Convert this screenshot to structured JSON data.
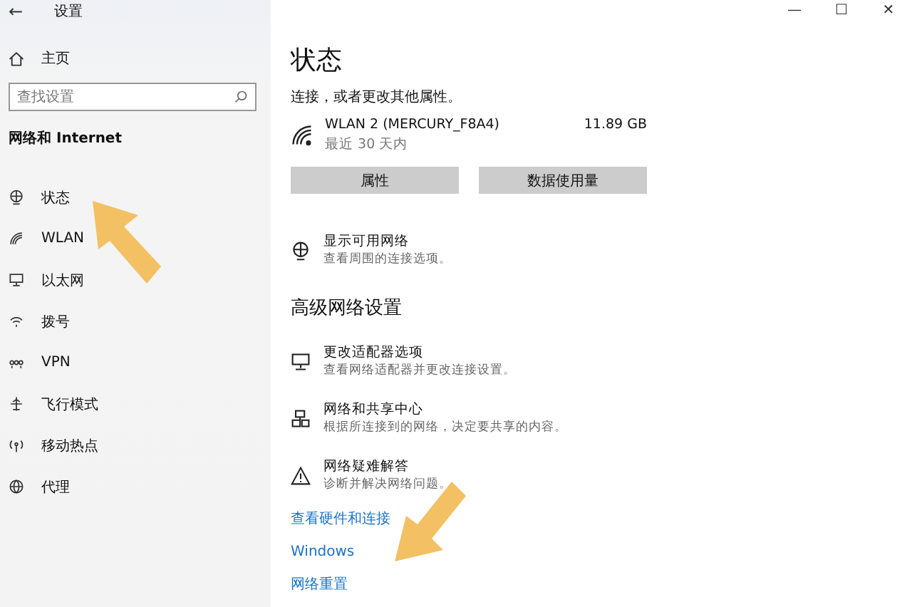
{
  "window": {
    "title": "设置",
    "back": "←",
    "controls": [
      "—",
      "☐",
      "✕"
    ]
  },
  "sidebar": {
    "home": "主页",
    "search": {
      "placeholder": "查找设置"
    },
    "heading": "网络和 Internet",
    "items": [
      {
        "label": "状态"
      },
      {
        "label": "WLAN"
      },
      {
        "label": "以太网"
      },
      {
        "label": "拨号"
      },
      {
        "label": "VPN"
      },
      {
        "label": "飞行模式"
      },
      {
        "label": "移动热点"
      },
      {
        "label": "代理"
      }
    ]
  },
  "main": {
    "title": "状态",
    "description": "连接，或者更改其他属性。",
    "connection": {
      "name": "WLAN 2 (MERCURY_F8A4)",
      "period": "最近 30 天内",
      "usage": "11.89 GB"
    },
    "buttons": [
      "属性",
      "数据使用量"
    ],
    "show_networks": {
      "title": "显示可用网络",
      "subtitle": "查看周围的连接选项。"
    },
    "advanced_heading": "高级网络设置",
    "advanced_items": [
      {
        "title": "更改适配器选项",
        "subtitle": "查看网络适配器并更改连接设置。"
      },
      {
        "title": "网络和共享中心",
        "subtitle": "根据所连接到的网络，决定要共享的内容。"
      },
      {
        "title": "网络疑难解答",
        "subtitle": "诊断并解决网络问题。"
      }
    ],
    "links": [
      "查看硬件和连接",
      "Windows",
      "网络重置"
    ]
  }
}
